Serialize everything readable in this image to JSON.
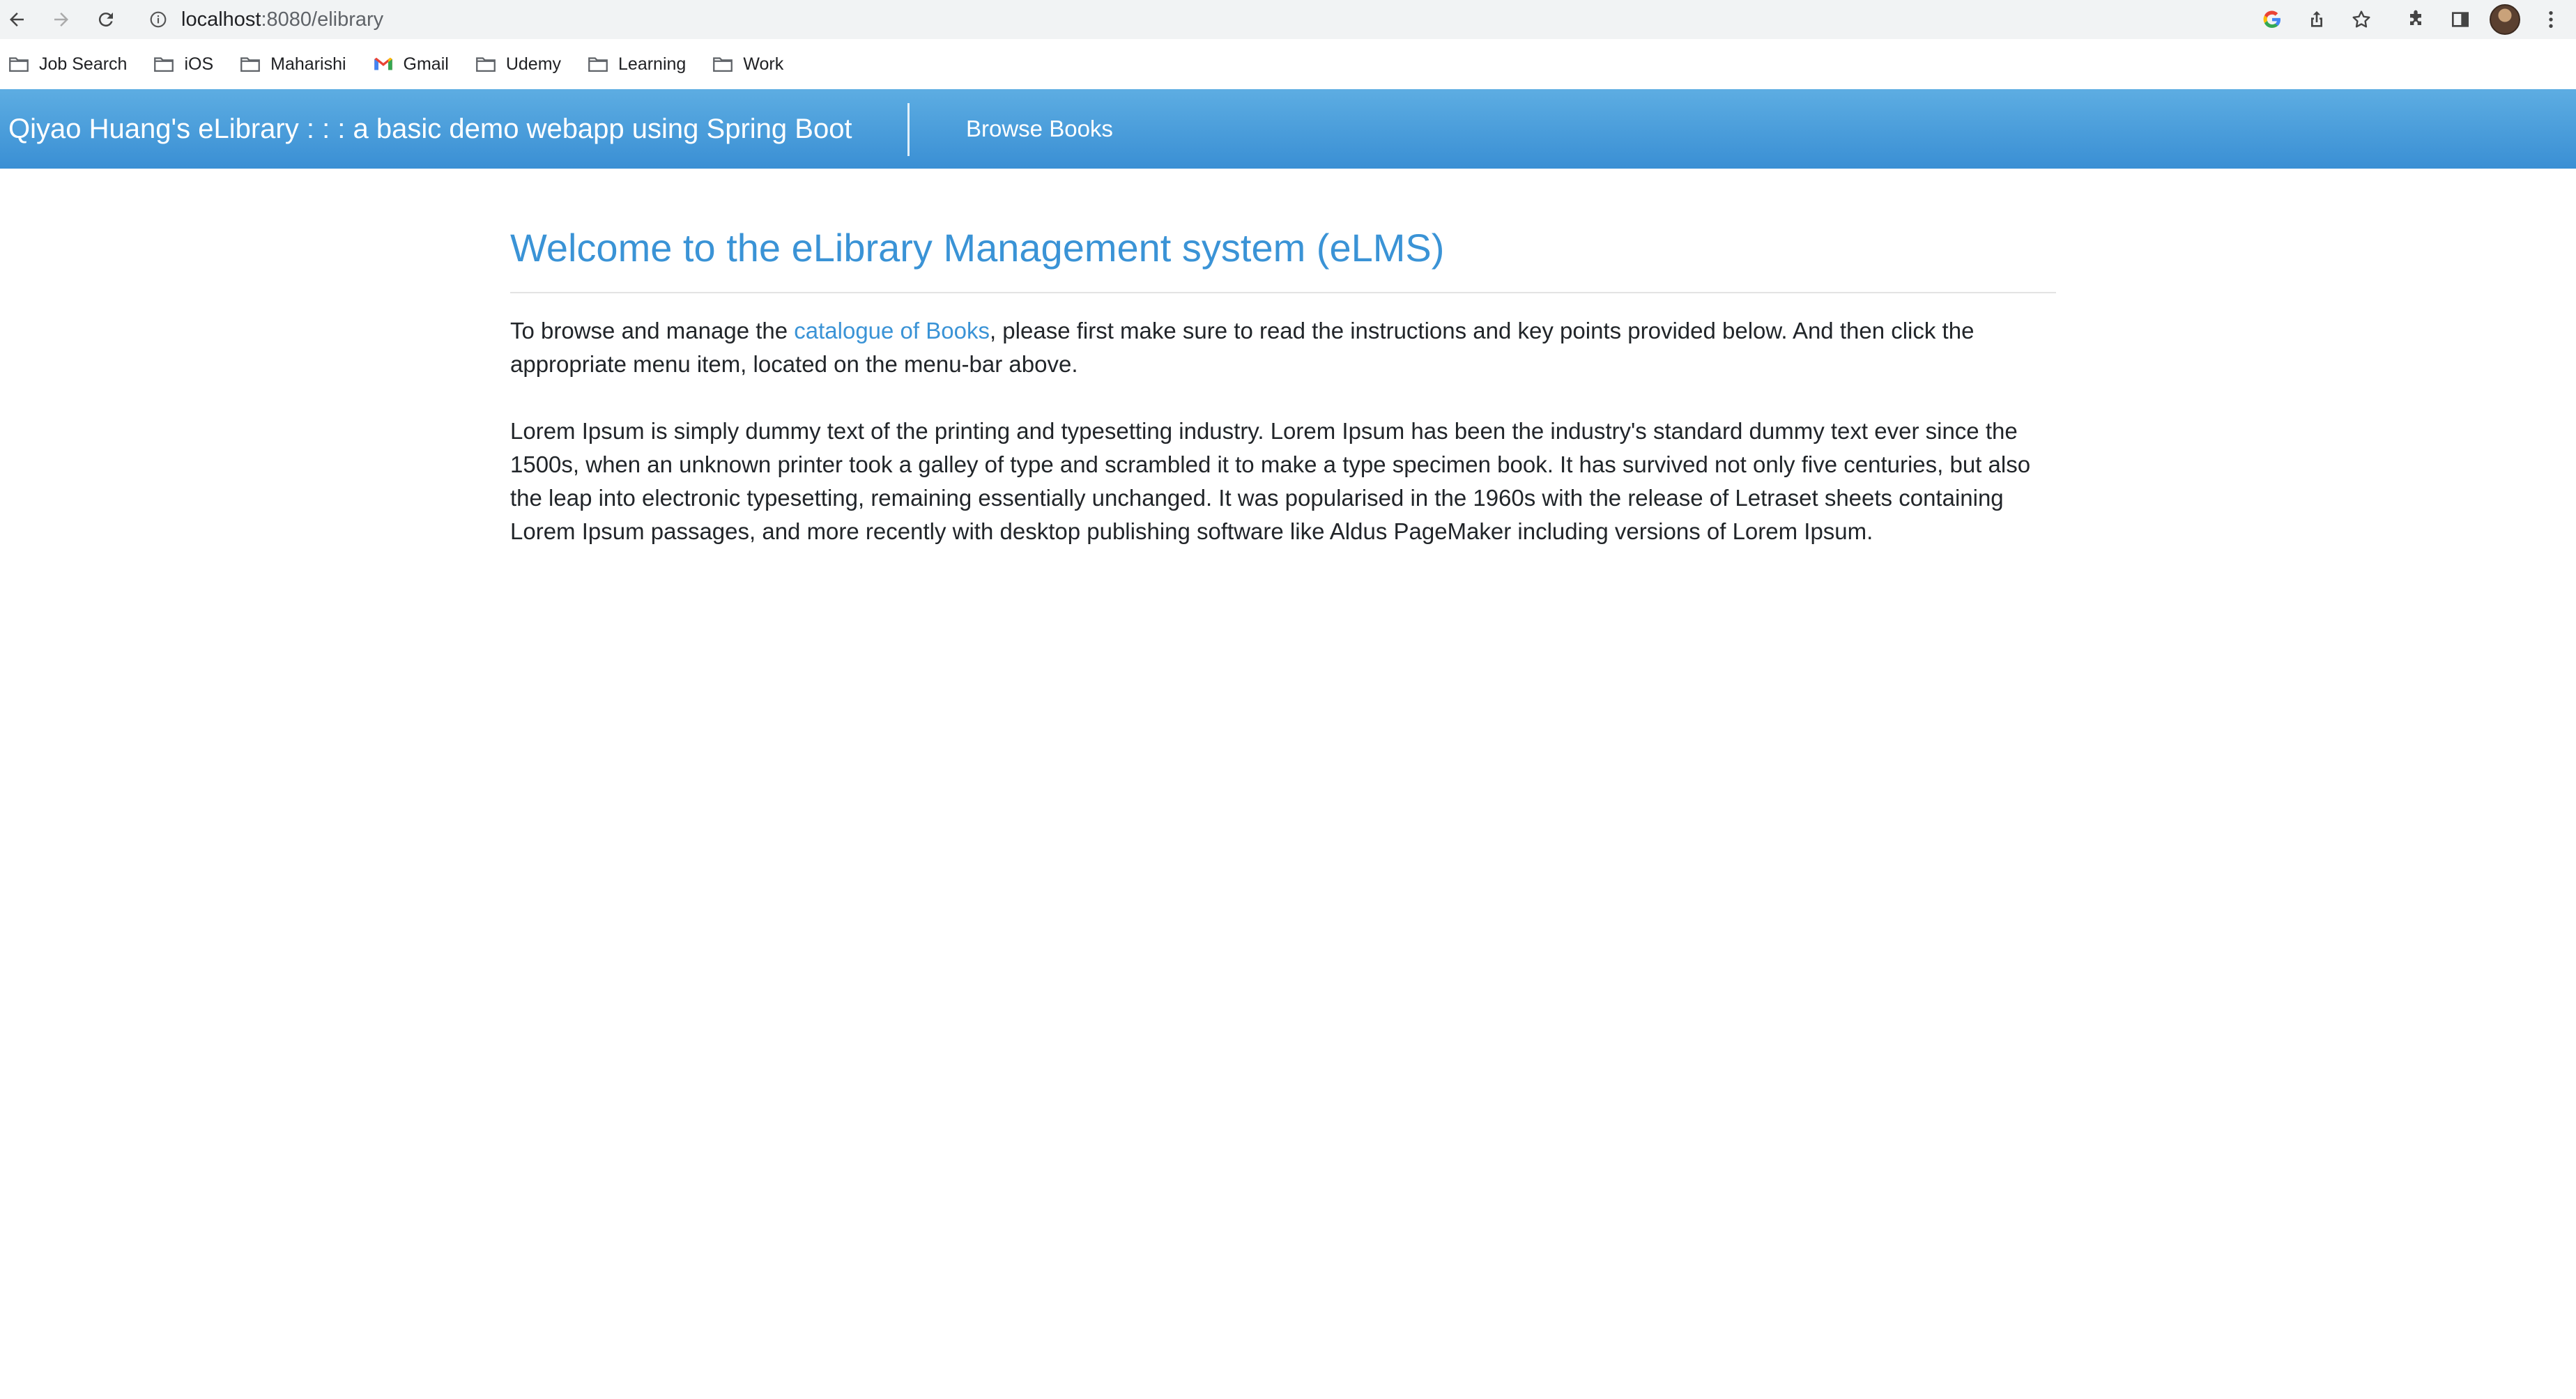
{
  "browser": {
    "url_host": "localhost",
    "url_path": ":8080/elibrary"
  },
  "bookmarks": [
    {
      "label": "Job Search",
      "icon": "folder-icon"
    },
    {
      "label": "iOS",
      "icon": "folder-icon"
    },
    {
      "label": "Maharishi",
      "icon": "folder-icon"
    },
    {
      "label": "Gmail",
      "icon": "gmail-icon"
    },
    {
      "label": "Udemy",
      "icon": "folder-icon"
    },
    {
      "label": "Learning",
      "icon": "folder-icon"
    },
    {
      "label": "Work",
      "icon": "folder-icon"
    }
  ],
  "navbar": {
    "brand": "Qiyao Huang's eLibrary : : : a basic demo webapp using Spring Boot",
    "browse_link": "Browse Books",
    "gradient_top": "#5dade2",
    "gradient_bottom": "#3a8fd4"
  },
  "main": {
    "title": "Welcome to the eLibrary Management system (eLMS)",
    "intro_before": "To browse and manage the ",
    "intro_link": "catalogue of Books",
    "intro_after": ", please first make sure to read the instructions and key points provided below. And then click the appropriate menu item, located on the menu-bar above.",
    "lorem": "Lorem Ipsum is simply dummy text of the printing and typesetting industry. Lorem Ipsum has been the industry's standard dummy text ever since the 1500s, when an unknown printer took a galley of type and scrambled it to make a type specimen book. It has survived not only five centuries, but also the leap into electronic typesetting, remaining essentially unchanged. It was popularised in the 1960s with the release of Letraset sheets containing Lorem Ipsum passages, and more recently with desktop publishing software like Aldus PageMaker including versions of Lorem Ipsum.",
    "accent_color": "#3a93d6"
  }
}
